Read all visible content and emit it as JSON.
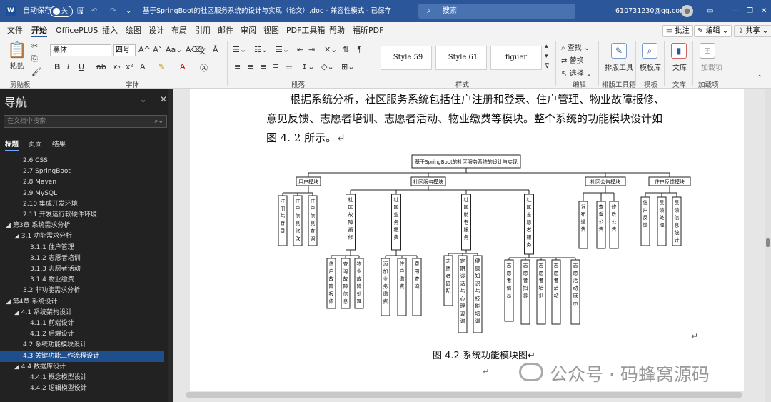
{
  "titlebar": {
    "autosave_label": "自动保存",
    "autosave_state": "关",
    "doc_title": "基于SpringBoot的社区服务系统的设计与实现（论文）.doc - 兼容性模式 - 已保存",
    "search_placeholder": "搜索",
    "account": "610731230@qq.com"
  },
  "tabs": [
    "文件",
    "开始",
    "OfficePLUS",
    "插入",
    "绘图",
    "设计",
    "布局",
    "引用",
    "邮件",
    "审阅",
    "视图",
    "PDF工具箱",
    "帮助",
    "福昕PDF"
  ],
  "tab_right": {
    "comments": "批注",
    "edit": "编辑",
    "share": "共享"
  },
  "ribbon": {
    "groups": [
      "剪贴板",
      "字体",
      "段落",
      "样式",
      "编辑",
      "排版工具箱",
      "模板",
      "文库",
      "加载项"
    ],
    "paste": "粘贴",
    "font_name": "黑体",
    "font_size": "四号",
    "styles": [
      "_Style 59",
      "_Style 61",
      "figuer"
    ],
    "find": "查找",
    "replace": "替换",
    "select": "选择",
    "typeset": "排版工具",
    "template": "模板库",
    "library": "文库",
    "addin": "加载项"
  },
  "nav": {
    "title": "导航",
    "search_placeholder": "在文档中搜索",
    "tabs": [
      "标题",
      "页面",
      "结果"
    ],
    "items": [
      "2.6 CSS",
      "2.7 SpringBoot",
      "2.8 Maven",
      "2.9 MySQL",
      "2.10 集成开发环境",
      "2.11 开发运行软硬件环境",
      "第3章 系统需求分析",
      "3.1 功能需求分析",
      "3.1.1 住户管理",
      "3.1.2 志愿者培训",
      "3.1.3 志愿者活动",
      "3.1.4 物业缴费",
      "3.2 非功能需求分析",
      "第4章 系统设计",
      "4.1 系统架构设计",
      "4.1.1 前端设计",
      "4.1.2 后端设计",
      "4.2 系统功能模块设计",
      "4.3 关键功能工作流程设计",
      "4.4 数据库设计",
      "4.4.1 概念模型设计",
      "4.4.2 逻辑模型设计"
    ]
  },
  "doc": {
    "lines": [
      "根据系统分析，社区服务系统包括住户注册和登录、住户管理、物业故障报修、",
      "意见反馈、志愿者培训、志愿者活动、物业缴费等模块。整个系统的功能模块设计如",
      "图 4. 2 所示。↵"
    ],
    "caption": "图 4.2  系统功能模块图↵",
    "watermark": "公众号 · 码蜂窝源码",
    "diagram": {
      "root": "基于SpringBoot的社区服务系统的设计与实现",
      "modules": [
        "用户模块",
        "社区服务模块",
        "社区公告模块",
        "住户反馈模块"
      ],
      "user_leaves": [
        "注册与登录",
        "住户信息修改",
        "住户信息查询"
      ],
      "service_subs": [
        "社区故障报修",
        "社区业务缴费",
        "社区助老服务",
        "社区志愿者服务"
      ],
      "repair_leaves": [
        "住户故障报修",
        "查询故障信息",
        "物业故障处理"
      ],
      "pay_leaves": [
        "添加业务缴费",
        "住户缴费",
        "费用查询"
      ],
      "elder_leaves": [
        "志愿者匹配",
        "定期谈话与心理咨询",
        "健康知识与技能培训"
      ],
      "vol_leaves": [
        "志愿者信息",
        "志愿者招募",
        "志愿者培训",
        "志愿者活动",
        "志愿活动展示"
      ],
      "notice_leaves": [
        "发布通告",
        "查看公告",
        "修改公告"
      ],
      "feedback_leaves": [
        "住户反馈",
        "反馈处理",
        "反馈信息统计"
      ]
    }
  }
}
